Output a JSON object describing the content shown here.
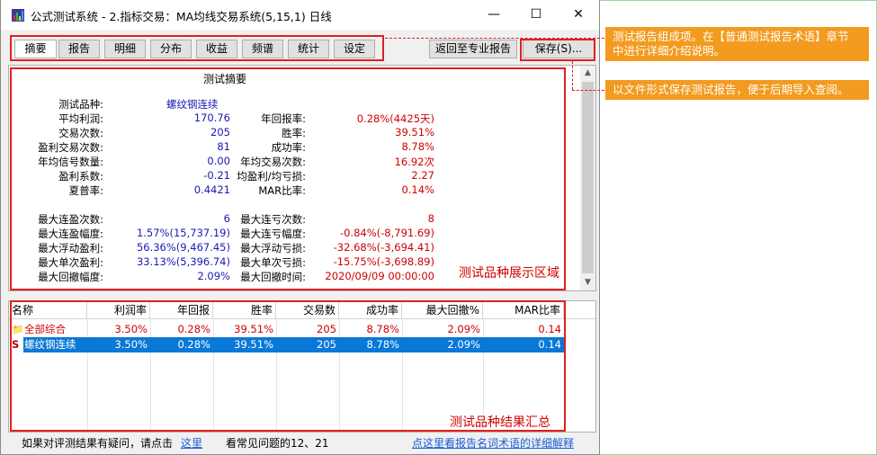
{
  "window": {
    "title": "公式测试系统 - 2.指标交易：MA均线交易系统(5,15,1) 日线",
    "minimize": "—",
    "maximize": "☐",
    "close": "✕"
  },
  "tabs": [
    "摘要",
    "报告",
    "明细",
    "分布",
    "收益",
    "频谱",
    "统计",
    "设定"
  ],
  "actions": {
    "back": "返回至专业报告",
    "save": "保存(S)..."
  },
  "summary": {
    "title": "测试摘要",
    "product_label": "测试品种:",
    "product_value": "螺纹钢连续",
    "rows_top": [
      {
        "l1": "平均利润:",
        "v1": "170.76",
        "l2": "年回报率:",
        "v2": "0.28%(4425天)"
      },
      {
        "l1": "交易次数:",
        "v1": "205",
        "l2": "胜率:",
        "v2": "39.51%"
      },
      {
        "l1": "盈利交易次数:",
        "v1": "81",
        "l2": "成功率:",
        "v2": "8.78%"
      },
      {
        "l1": "年均信号数量:",
        "v1": "0.00",
        "l2": "年均交易次数:",
        "v2": "16.92次"
      },
      {
        "l1": "盈利系数:",
        "v1": "-0.21",
        "l2": "均盈利/均亏损:",
        "v2": "2.27"
      },
      {
        "l1": "夏普率:",
        "v1": "0.4421",
        "l2": "MAR比率:",
        "v2": "0.14%"
      }
    ],
    "rows_bottom": [
      {
        "l1": "最大连盈次数:",
        "v1": "6",
        "l2": "最大连亏次数:",
        "v2": "8"
      },
      {
        "l1": "最大连盈幅度:",
        "v1": "1.57%(15,737.19)",
        "l2": "最大连亏幅度:",
        "v2": "-0.84%(-8,791.69)"
      },
      {
        "l1": "最大浮动盈利:",
        "v1": "56.36%(9,467.45)",
        "l2": "最大浮动亏损:",
        "v2": "-32.68%(-3,694.41)"
      },
      {
        "l1": "最大单次盈利:",
        "v1": "33.13%(5,396.74)",
        "l2": "最大单次亏损:",
        "v2": "-15.75%(-3,698.89)"
      },
      {
        "l1": "最大回撤幅度:",
        "v1": "2.09%",
        "l2": "最大回撤时间:",
        "v2": "2020/09/09 00:00:00"
      }
    ],
    "annotation": "测试品种展示区域"
  },
  "results": {
    "columns": [
      "名称",
      "利润率",
      "年回报",
      "胜率",
      "交易数",
      "成功率",
      "最大回撤%",
      "MAR比率"
    ],
    "rows": [
      {
        "icon": "📁",
        "name": "全部综合",
        "cells": [
          "3.50%",
          "0.28%",
          "39.51%",
          "205",
          "8.78%",
          "2.09%",
          "0.14"
        ]
      },
      {
        "icon": "S",
        "name": "螺纹钢连续",
        "cells": [
          "3.50%",
          "0.28%",
          "39.51%",
          "205",
          "8.78%",
          "2.09%",
          "0.14"
        ]
      }
    ],
    "annotation": "测试品种结果汇总"
  },
  "status": {
    "prefix": "如果对评测结果有疑问，请点击",
    "link_here": "这里",
    "faq": "看常见问题的12、21",
    "link_terms": "点这里看报告名词术语的详细解释"
  },
  "notes": {
    "tabs_note_line1": "测试报告组成项。在【普通测试报告术语】章节",
    "tabs_note_line2": "中进行详细介绍说明。",
    "save_note": "以文件形式保存测试报告，便于后期导入查阅。"
  },
  "colors": {
    "highlight": "#e02020",
    "note_bg": "#f29b1f",
    "selection": "#0a78d7",
    "positive": "#d00000",
    "value": "#1a1ab4"
  }
}
